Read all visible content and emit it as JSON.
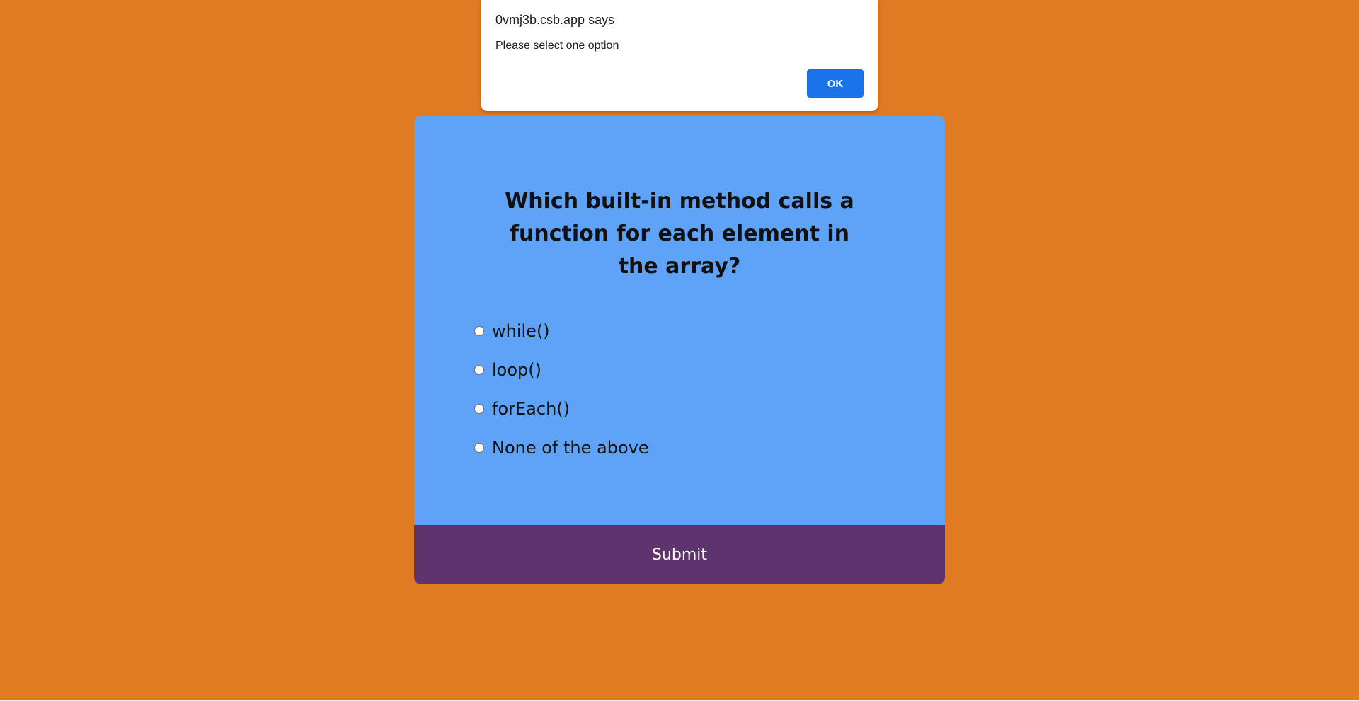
{
  "alert": {
    "title": "0vmj3b.csb.app says",
    "message": "Please select one option",
    "ok_label": "OK"
  },
  "quiz": {
    "question": "Which built-in method calls a function for each element in the array?",
    "options": [
      {
        "label": "while()"
      },
      {
        "label": "loop()"
      },
      {
        "label": "forEach()"
      },
      {
        "label": "None of the above"
      }
    ],
    "submit_label": "Submit"
  },
  "colors": {
    "background": "#e07b24",
    "card": "#5ea3f8",
    "submit": "#5e336e",
    "alert_button": "#1a73e8"
  }
}
